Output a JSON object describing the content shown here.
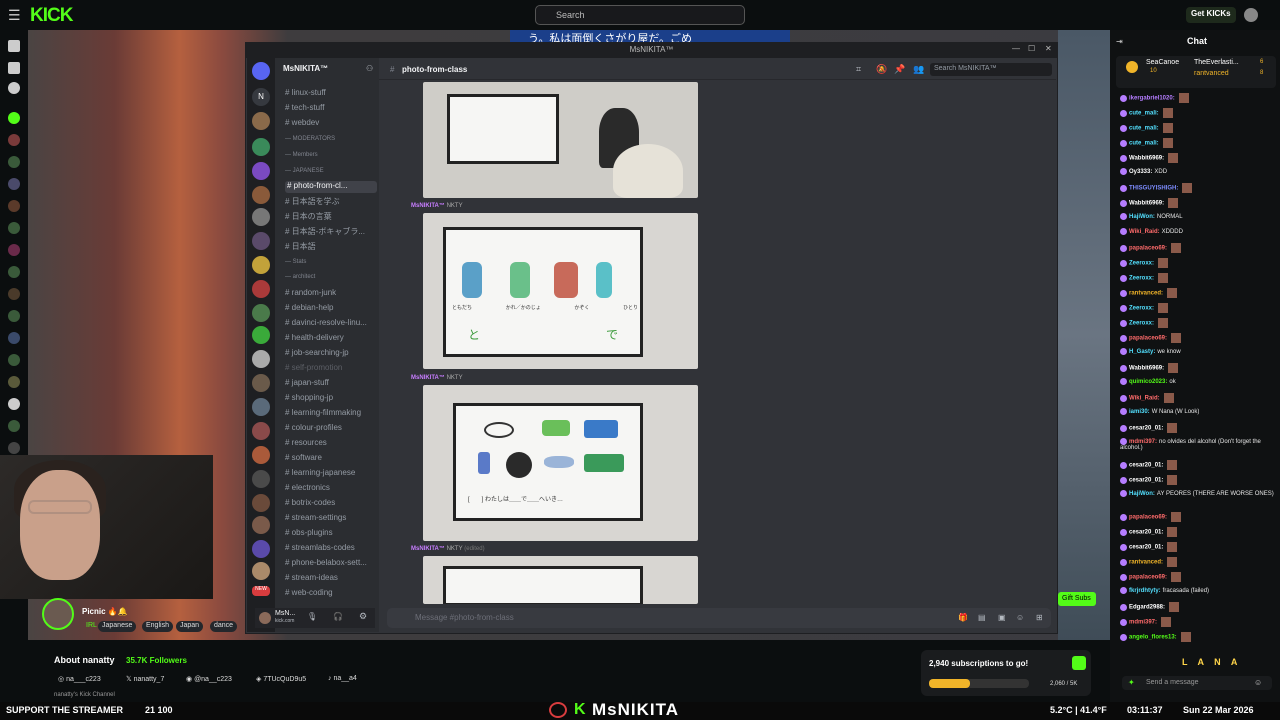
{
  "kick": {
    "search_placeholder": "Search",
    "get_kicks": "Get KICKs",
    "logo": "KICK"
  },
  "stream": {
    "sign_text": "う。私は面倒くさがり屋だ。ごめ",
    "title": "Picnic 🔥🔔",
    "tags": [
      "IRL",
      "Japanese",
      "English",
      "Japan",
      "dance"
    ]
  },
  "about": {
    "title": "About nanatty",
    "followers": "35.7K Followers",
    "socials": [
      "na___c223",
      "nanatty_7",
      "@na__c223",
      "7TUcQuD9u5",
      "na__a4"
    ],
    "channel": "nanatty's Kick Channel"
  },
  "subs": {
    "label": "2,940 subscriptions to go!",
    "count": "2,060 / 5K",
    "progress": 0.41,
    "gift": "Gift Subs"
  },
  "discord": {
    "window_title": "MsNIKITA™",
    "server_name": "MsNIKITA™",
    "channel_title": "photo-from-class",
    "search_placeholder": "Search MsNIKITA™",
    "input_placeholder": "Message #photo-from-class",
    "user_name": "MsN...",
    "user_status": "kick.com",
    "channels": [
      {
        "label": "linux-stuff"
      },
      {
        "label": "tech-stuff"
      },
      {
        "label": "webdev"
      },
      {
        "label": "MODERATORS"
      },
      {
        "label": "Members"
      },
      {
        "label": "JAPANESE"
      },
      {
        "label": "photo-from-cl..."
      },
      {
        "label": "日本語を学ぶ"
      },
      {
        "label": "日本の言葉"
      },
      {
        "label": "日本語-ボキャブラ..."
      },
      {
        "label": "日本語"
      },
      {
        "label": "Stats"
      },
      {
        "label": "architect"
      },
      {
        "label": "random-junk"
      },
      {
        "label": "debian-help"
      },
      {
        "label": "davinci-resolve-linu..."
      },
      {
        "label": "health-delivery"
      },
      {
        "label": "job-searching-jp"
      },
      {
        "label": "self-promotion"
      },
      {
        "label": "japan-stuff"
      },
      {
        "label": "shopping-jp"
      },
      {
        "label": "learning-filmmaking"
      },
      {
        "label": "colour-profiles"
      },
      {
        "label": "resources"
      },
      {
        "label": "software"
      },
      {
        "label": "learning-japanese"
      },
      {
        "label": "electronics"
      },
      {
        "label": "botrix-codes"
      },
      {
        "label": "stream-settings"
      },
      {
        "label": "obs-plugins"
      },
      {
        "label": "streamlabs-codes"
      },
      {
        "label": "phone-belabox-sett..."
      },
      {
        "label": "stream-ideas"
      },
      {
        "label": "web-coding"
      }
    ],
    "post_author": "MsNIKITA™",
    "post_badge": "NKTY",
    "edited": "(edited)",
    "slide2_words": [
      "ともだち",
      "かれ／かのじょ",
      "かぞく",
      "ひとり"
    ],
    "slide2_particles": [
      "と",
      "で"
    ],
    "slide3_sentence": "[　　] わたしは＿＿で＿＿へいき…"
  },
  "chat": {
    "title": "Chat",
    "pinned_user": "SeaCanoe",
    "pinned_sub": "TheEverlasti...",
    "pinned_user2": "rantvanced",
    "pinned_count1": "6",
    "pinned_count2": "10",
    "pinned_count3": "8",
    "send_placeholder": "Send a message",
    "bottom_emotes": "L A N A",
    "messages": [
      {
        "user": "ikergabriel1020:",
        "text": "",
        "color": "#b57dff"
      },
      {
        "user": "cute_mali:",
        "text": "",
        "color": "#53e0ff"
      },
      {
        "user": "cute_mali:",
        "text": "",
        "color": "#53e0ff"
      },
      {
        "user": "cute_mali:",
        "text": "",
        "color": "#53e0ff"
      },
      {
        "user": "Wabbit6969:",
        "text": "",
        "color": "#ffffff"
      },
      {
        "user": "Oy3333:",
        "text": "XDD",
        "color": "#ffffff"
      },
      {
        "user": "THISGUYISHIGH:",
        "text": "",
        "color": "#7d8cff"
      },
      {
        "user": "Wabbit6969:",
        "text": "",
        "color": "#ffffff"
      },
      {
        "user": "HajiWon:",
        "text": "NORMAL",
        "color": "#53e0ff"
      },
      {
        "user": "Wiki_Raid:",
        "text": "XDDDD",
        "color": "#ff6b6b"
      },
      {
        "user": "papalaceo69:",
        "text": "",
        "color": "#ff6b6b"
      },
      {
        "user": "Zeeroxx:",
        "text": "",
        "color": "#53e0ff"
      },
      {
        "user": "Zeeroxx:",
        "text": "",
        "color": "#53e0ff"
      },
      {
        "user": "rantvanced:",
        "text": "",
        "color": "#f0b429"
      },
      {
        "user": "Zeeroxx:",
        "text": "",
        "color": "#53e0ff"
      },
      {
        "user": "Zeeroxx:",
        "text": "",
        "color": "#53e0ff"
      },
      {
        "user": "papalaceo69:",
        "text": "",
        "color": "#ff6b6b"
      },
      {
        "user": "H_Gasty:",
        "text": "we know",
        "color": "#53e0ff"
      },
      {
        "user": "Wabbit6969:",
        "text": "",
        "color": "#ffffff"
      },
      {
        "user": "quimico2023:",
        "text": "ok",
        "color": "#53fc18"
      },
      {
        "user": "Wiki_Raid:",
        "text": "",
        "color": "#ff6b6b"
      },
      {
        "user": "iami30:",
        "text": "W Nana (W Look)",
        "color": "#53e0ff"
      },
      {
        "user": "cesar20_01:",
        "text": "",
        "color": "#ffffff"
      },
      {
        "user": "mdmi397:",
        "text": "no olvides del alcohol (Don't forget the alcohol.)",
        "color": "#ff6b6b"
      },
      {
        "user": "cesar20_01:",
        "text": "",
        "color": "#ffffff"
      },
      {
        "user": "cesar20_01:",
        "text": "",
        "color": "#ffffff"
      },
      {
        "user": "HajiWon:",
        "text": "AY PEORES (THERE ARE WORSE ONES)",
        "color": "#53e0ff"
      },
      {
        "user": "papalaceo69:",
        "text": "",
        "color": "#ff6b6b"
      },
      {
        "user": "cesar20_01:",
        "text": "",
        "color": "#ffffff"
      },
      {
        "user": "cesar20_01:",
        "text": "",
        "color": "#ffffff"
      },
      {
        "user": "rantvanced:",
        "text": "",
        "color": "#f0b429"
      },
      {
        "user": "papalaceo69:",
        "text": "",
        "color": "#ff6b6b"
      },
      {
        "user": "fkrjrdhtyty:",
        "text": "fracasada (failed)",
        "color": "#53e0ff"
      },
      {
        "user": "Edgard2988:",
        "text": "",
        "color": "#ffffff"
      },
      {
        "user": "mdmi397:",
        "text": "",
        "color": "#ff6b6b"
      },
      {
        "user": "angelo_flores13:",
        "text": "",
        "color": "#53fc18"
      }
    ]
  },
  "taskbar": {
    "support": "SUPPORT THE STREAMER",
    "counter": "21 100",
    "brand": "MsNIKITA",
    "weather": "5.2°C | 41.4°F",
    "clock": "03:11:37",
    "date": "Sun 22 Mar 2026"
  }
}
